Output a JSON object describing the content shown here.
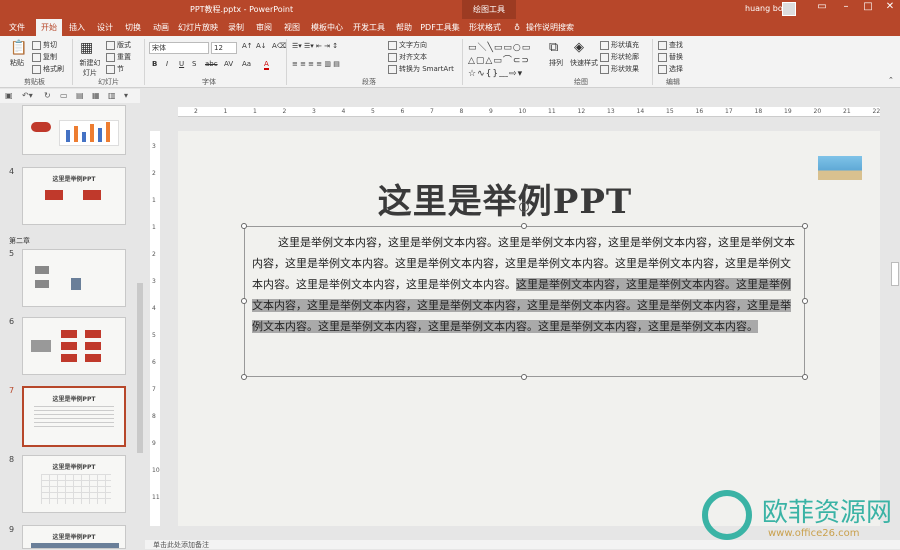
{
  "window": {
    "title": "PPT教程.pptx  -  PowerPoint",
    "context_tab": "绘图工具",
    "user": "huang bo"
  },
  "tabs": [
    "文件",
    "开始",
    "插入",
    "设计",
    "切换",
    "动画",
    "幻灯片放映",
    "录制",
    "审阅",
    "视图",
    "模板中心",
    "开发工具",
    "帮助",
    "PDF工具集",
    "形状格式",
    "操作说明搜索"
  ],
  "ribbon": {
    "clipboard": {
      "paste": "粘贴",
      "cut": "剪切",
      "copy": "复制",
      "format_painter": "格式刷",
      "group": "剪贴板"
    },
    "slides": {
      "new_slide": "新建幻灯片",
      "layout": "版式",
      "reset": "重置",
      "section": "节",
      "group": "幻灯片"
    },
    "font": {
      "font_name": "宋体",
      "font_size": "12",
      "group": "字体",
      "buttons": [
        "B",
        "I",
        "U",
        "S",
        "abc",
        "AV",
        "Aa",
        "A"
      ]
    },
    "paragraph": {
      "text_direction": "文字方向",
      "align_text": "对齐文本",
      "smartart": "转换为 SmartArt",
      "group": "段落"
    },
    "drawing": {
      "arrange": "排列",
      "quick_styles": "快速样式",
      "shape_fill": "形状填充",
      "shape_outline": "形状轮廓",
      "shape_effects": "形状效果",
      "group": "绘图"
    },
    "editing": {
      "find": "查找",
      "replace": "替换",
      "select": "选择",
      "group": "编辑"
    }
  },
  "thumbs": {
    "numbers": [
      "4",
      "5",
      "6",
      "7",
      "8",
      "9"
    ],
    "section": "第二章",
    "titles": [
      "这里是举例PPT",
      "",
      "",
      "这里是举例PPT",
      "这里是举例PPT",
      "这里是举例PPT"
    ]
  },
  "ruler": {
    "h": [
      "2",
      "1",
      "1",
      "2",
      "3",
      "4",
      "5",
      "6",
      "7",
      "8",
      "9",
      "10",
      "11",
      "12",
      "13",
      "14",
      "15",
      "16",
      "17",
      "18",
      "19",
      "20",
      "21",
      "22"
    ],
    "v": [
      "3",
      "2",
      "1",
      "1",
      "2",
      "3",
      "4",
      "5",
      "6",
      "7",
      "8",
      "9",
      "10",
      "11"
    ]
  },
  "slide": {
    "title": "这里是举例PPT",
    "body_plain": "这里是举例文本内容，这里是举例文本内容。这里是举例文本内容，这里是举例文本内容，这里是举例文本内容，这里是举例文本内容。这里是举例文本内容，这里是举例文本内容。这里是举例文本内容，这里是举例文本内容。这里是举例文本内容，这里是举例文本内容。",
    "body_selected": "这里是举例文本内容，这里是举例文本内容。这里是举例文本内容，这里是举例文本内容，这里是举例文本内容，这里是举例文本内容。这里是举例文本内容，这里是举例文本内容。这里是举例文本内容，这里是举例文本内容。这里是举例文本内容，这里是举例文本内容。"
  },
  "notes_placeholder": "单击此处添加备注",
  "watermark": {
    "cn": "欧菲资源网",
    "url": "www.office26.com"
  }
}
